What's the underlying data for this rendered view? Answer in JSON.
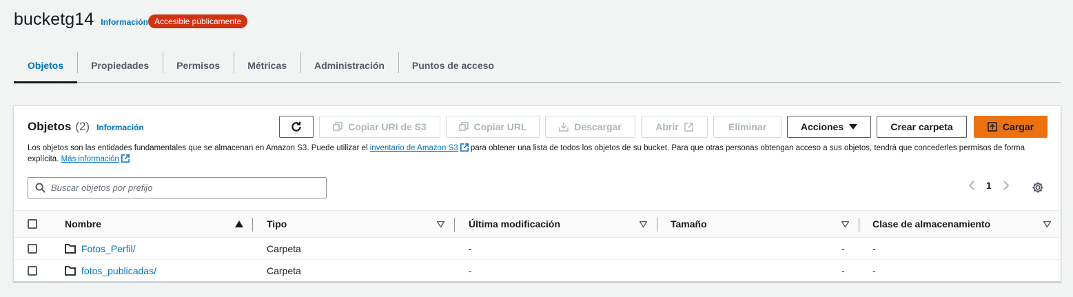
{
  "header": {
    "bucket_name": "bucketg14",
    "info_label": "Información",
    "public_badge": "Accesible públicamente"
  },
  "tabs": [
    {
      "label": "Objetos",
      "active": true
    },
    {
      "label": "Propiedades",
      "active": false
    },
    {
      "label": "Permisos",
      "active": false
    },
    {
      "label": "Métricas",
      "active": false
    },
    {
      "label": "Administración",
      "active": false
    },
    {
      "label": "Puntos de acceso",
      "active": false
    }
  ],
  "panel": {
    "title": "Objetos",
    "count": "(2)",
    "info_label": "Información",
    "description_part1": "Los objetos son las entidades fundamentales que se almacenan en Amazon S3. Puede utilizar el",
    "inventory_link": "inventario de Amazon S3",
    "description_part2": "para obtener una lista de todos los objetos de su bucket. Para que otras personas obtengan acceso a sus objetos, tendrá que concederles permisos de forma explícita.",
    "more_info_link": "Más información"
  },
  "toolbar": {
    "refresh_icon": "refresh-icon",
    "copy_uri_label": "Copiar URI de S3",
    "copy_url_label": "Copiar URL",
    "download_label": "Descargar",
    "open_label": "Abrir",
    "delete_label": "Eliminar",
    "actions_label": "Acciones",
    "create_folder_label": "Crear carpeta",
    "upload_label": "Cargar"
  },
  "search": {
    "placeholder": "Buscar objetos por prefijo"
  },
  "pagination": {
    "current_page": "1"
  },
  "table": {
    "columns": [
      "Nombre",
      "Tipo",
      "Última modificación",
      "Tamaño",
      "Clase de almacenamiento"
    ],
    "rows": [
      {
        "name": "Fotos_Perfil/",
        "type": "Carpeta",
        "modified": "-",
        "size": "-",
        "storage_class": "-"
      },
      {
        "name": "fotos_publicadas/",
        "type": "Carpeta",
        "modified": "-",
        "size": "-",
        "storage_class": "-"
      }
    ]
  },
  "colors": {
    "link": "#0073bb",
    "badge_public": "#d13212",
    "primary_button": "#ec7211",
    "text": "#16191f"
  }
}
